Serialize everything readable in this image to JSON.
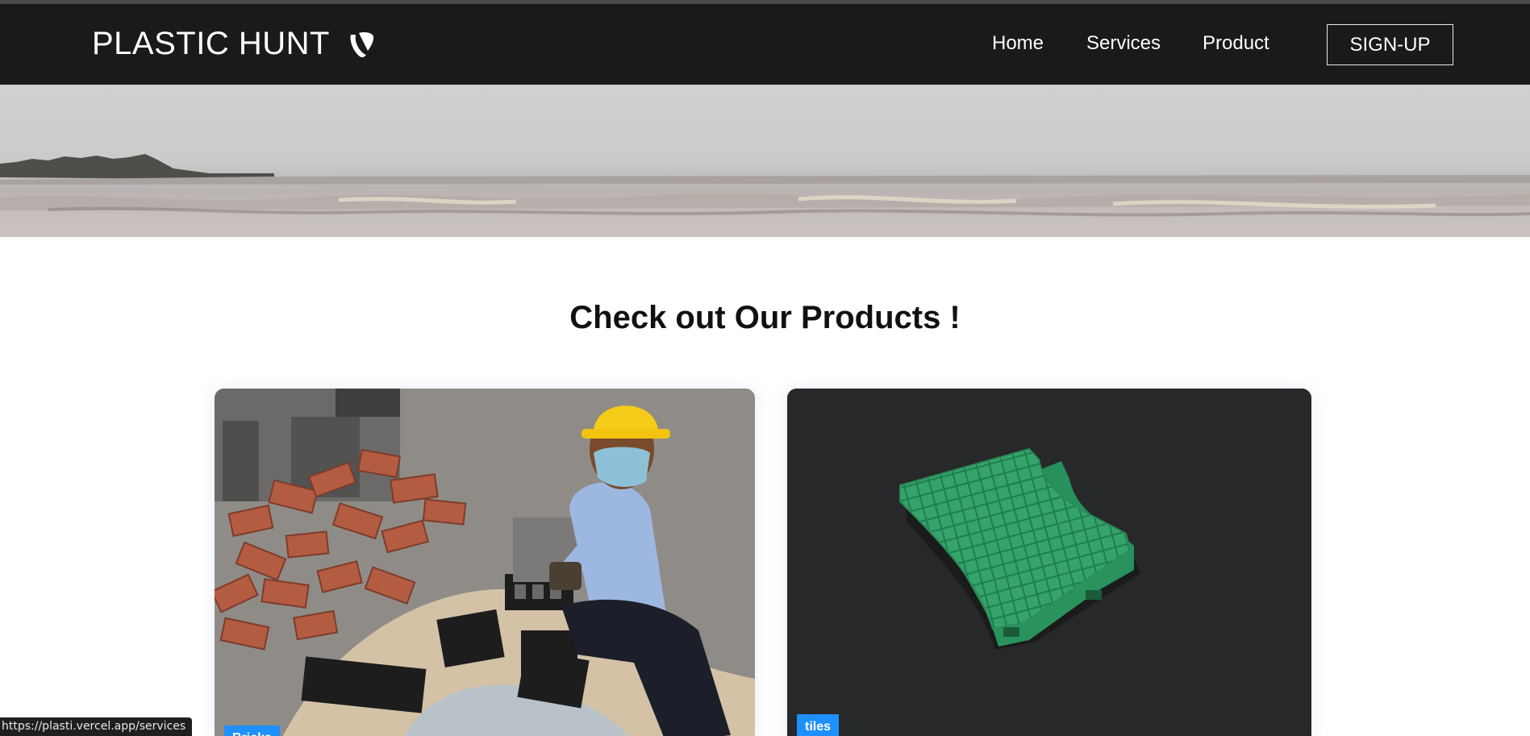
{
  "header": {
    "brand": "PLASTIC HUNT",
    "brand_icon": "typo3-icon",
    "nav": {
      "home": "Home",
      "services": "Services",
      "product": "Product"
    },
    "signup_label": "SIGN-UP"
  },
  "main": {
    "title": "Check out Our Products !",
    "cards": [
      {
        "tag": "Bricks",
        "image": "worker-with-bricks-photo"
      },
      {
        "tag": "tiles",
        "image": "green-plastic-tile-photo"
      }
    ]
  },
  "status_bar": {
    "url": "https://plasti.vercel.app/services"
  },
  "colors": {
    "navbar": "#1b1919",
    "tag": "#1e90ff",
    "text": "#111111"
  }
}
